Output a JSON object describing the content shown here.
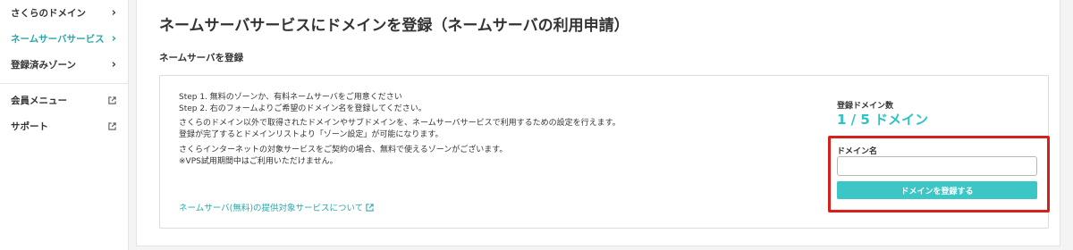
{
  "sidebar": {
    "items": [
      {
        "label": "さくらのドメイン",
        "indicator": "chevron-right-icon"
      },
      {
        "label": "ネームサーバサービス",
        "indicator": "chevron-right-icon",
        "active": true
      },
      {
        "label": "登録済みゾーン",
        "indicator": "chevron-right-icon"
      },
      {
        "label": "会員メニュー",
        "indicator": "external-link-icon"
      },
      {
        "label": "サポート",
        "indicator": "external-link-icon"
      }
    ]
  },
  "main": {
    "title": "ネームサーバサービスにドメインを登録（ネームサーバの利用申請）",
    "section_heading": "ネームサーバを登録",
    "description_lines": [
      "Step 1. 無料のゾーンか、有料ネームサーバをご用意ください",
      "Step 2. 右のフォームよりご希望のドメイン名を登録してください。",
      "さくらのドメイン以外で取得されたドメインやサブドメインを、ネームサーバサービスで利用するための設定を行えます。",
      "登録が完了するとドメインリストより「ゾーン設定」が可能になります。",
      "さくらインターネットの対象サービスをご契約の場合、無料で使えるゾーンがございます。",
      "※VPS試用期間中はご利用いただけません。"
    ],
    "help_link": "ネームサーバ(無料)の提供対象サービスについて",
    "registration": {
      "count_label": "登録ドメイン数",
      "count_value": "1 / 5 ドメイン",
      "field_label": "ドメイン名",
      "input_value": "",
      "input_placeholder": "",
      "submit_label": "ドメインを登録する"
    }
  },
  "colors": {
    "accent": "#2aa8a8",
    "button": "#3cc6c6",
    "count_value": "#2fc3c3",
    "highlight_border": "#d8201a"
  }
}
